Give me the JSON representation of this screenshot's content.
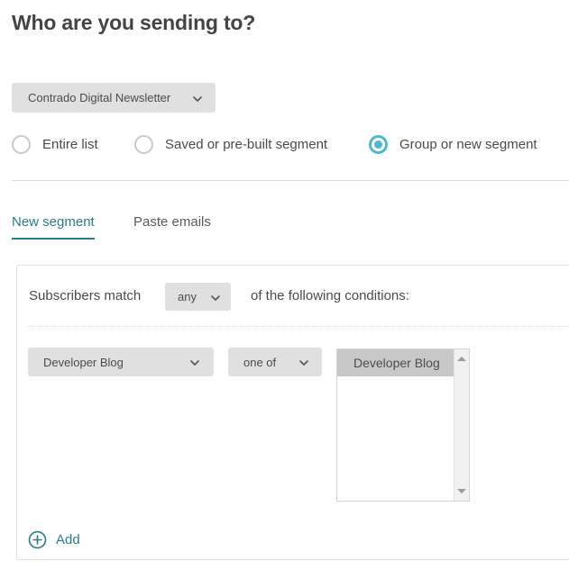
{
  "page": {
    "title": "Who are you sending to?"
  },
  "list_select": {
    "value": "Contrado Digital Newsletter",
    "caret_icon": "chevron-down-icon"
  },
  "audience_options": [
    {
      "id": "entire-list",
      "label": "Entire list",
      "checked": false
    },
    {
      "id": "saved-segment",
      "label": "Saved or pre-built segment",
      "checked": false
    },
    {
      "id": "group-or-new-segment",
      "label": "Group or new segment",
      "checked": true
    }
  ],
  "tabs": [
    {
      "id": "new-segment",
      "label": "New segment",
      "active": true
    },
    {
      "id": "paste-emails",
      "label": "Paste emails",
      "active": false
    }
  ],
  "segment_builder": {
    "match_prefix": "Subscribers match",
    "match_select": {
      "value": "any",
      "caret_icon": "chevron-down-icon"
    },
    "match_suffix": "of the following conditions:",
    "condition": {
      "field_select": {
        "value": "Developer Blog",
        "caret_icon": "chevron-down-icon"
      },
      "operator_select": {
        "value": "one of",
        "caret_icon": "chevron-down-icon"
      },
      "value_listbox": {
        "options": [
          {
            "label": "Developer Blog",
            "selected": true
          }
        ],
        "scrollbar": {
          "up_icon": "triangle-up-icon",
          "down_icon": "triangle-down-icon"
        }
      }
    },
    "add_label": "Add",
    "add_icon": "plus-circle-icon"
  },
  "colors": {
    "accent_teal": "#2a7b8f",
    "radio_checked": "#4cb8d4",
    "control_grey": "#e0e0e0",
    "selected_option_grey": "#c8c8c8",
    "text": "#4a4a4a",
    "heading": "#444444",
    "border": "#e2e2e2"
  }
}
